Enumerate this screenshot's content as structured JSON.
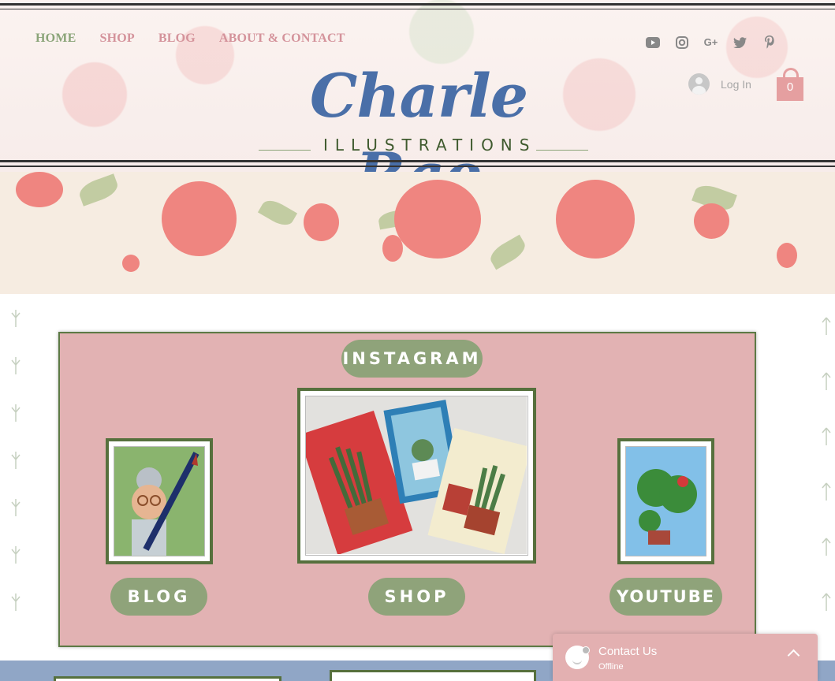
{
  "nav": {
    "items": [
      {
        "label": "HOME",
        "active": true
      },
      {
        "label": "SHOP",
        "active": false
      },
      {
        "label": "BLOG",
        "active": false
      },
      {
        "label": "ABOUT & CONTACT",
        "active": false
      }
    ]
  },
  "social": [
    "youtube-icon",
    "instagram-icon",
    "google-plus-icon",
    "twitter-icon",
    "pinterest-icon"
  ],
  "social_glyphs": {
    "gplus": "G+"
  },
  "login": {
    "label": "Log In"
  },
  "cart": {
    "count": "0"
  },
  "logo": {
    "title": "Charle Rae",
    "subtitle": "ILLUSTRATIONS"
  },
  "panel": {
    "instagram_label": "INSTAGRAM",
    "blog_label": "BLOG",
    "shop_label": "SHOP",
    "youtube_label": "YOUTUBE"
  },
  "chat": {
    "title": "Contact Us",
    "status": "Offline"
  },
  "colors": {
    "nav_active": "#8aa478",
    "nav": "#d4939b",
    "logo_blue": "#4a6fa8",
    "panel": "#e2b2b3",
    "pill": "#8fa37a",
    "frame": "#56703d"
  }
}
